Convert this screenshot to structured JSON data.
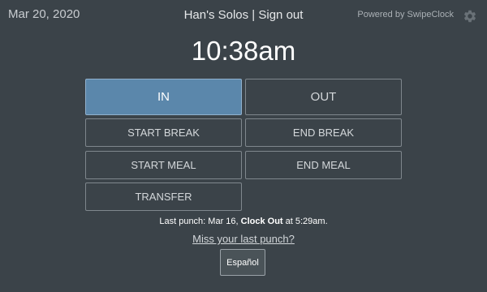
{
  "header": {
    "date": "Mar 20, 2020",
    "user_name": "Han's Solos",
    "separator": " | ",
    "sign_out": "Sign out",
    "powered_by": "Powered by SwipeClock",
    "settings_icon": "gear-icon"
  },
  "clock": {
    "time": "10:38am"
  },
  "punch_buttons": {
    "in": "IN",
    "out": "OUT",
    "start_break": "START BREAK",
    "end_break": "END BREAK",
    "start_meal": "START MEAL",
    "end_meal": "END MEAL",
    "transfer": "TRANSFER"
  },
  "last_punch": {
    "prefix": "Last punch: Mar 16, ",
    "action": "Clock Out",
    "suffix": " at 5:29am."
  },
  "miss_link": "Miss your last punch?",
  "language_button": "Español",
  "colors": {
    "background": "#3b4349",
    "active_button": "#5b87ab",
    "button_border": "#7f878d"
  }
}
